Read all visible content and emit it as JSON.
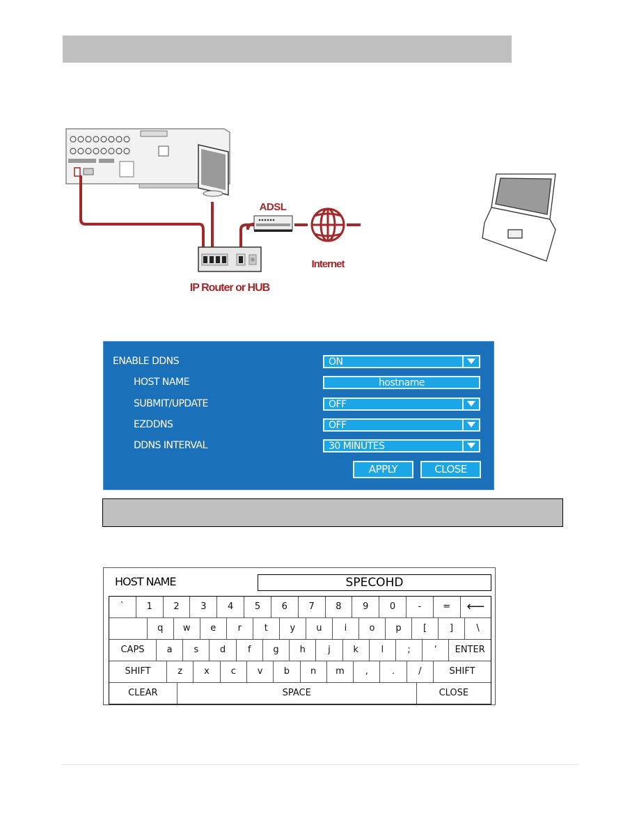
{
  "diagram": {
    "adsl_label": "ADSL",
    "internet_label": "Internet",
    "router_label": "IP Router or HUB",
    "cable_color": "#a3282a"
  },
  "ddns": {
    "rows": [
      {
        "label": "ENABLE DDNS",
        "value": "ON",
        "type": "dropdown"
      },
      {
        "label": "HOST NAME",
        "value": "hostname",
        "type": "text"
      },
      {
        "label": "SUBMIT/UPDATE",
        "value": "OFF",
        "type": "dropdown"
      },
      {
        "label": "EZDDNS",
        "value": "OFF",
        "type": "dropdown"
      },
      {
        "label": "DDNS INTERVAL",
        "value": "30 MINUTES",
        "type": "dropdown"
      }
    ],
    "apply_label": "APPLY",
    "close_label": "CLOSE",
    "bg_color": "#1b70ba",
    "field_color": "#1ba6e8"
  },
  "keyboard": {
    "title": "HOST NAME",
    "input_value": "SPECOHD",
    "rows": [
      [
        {
          "k": "`",
          "w": 1
        },
        {
          "k": "1",
          "w": 1
        },
        {
          "k": "2",
          "w": 1
        },
        {
          "k": "3",
          "w": 1
        },
        {
          "k": "4",
          "w": 1
        },
        {
          "k": "5",
          "w": 1
        },
        {
          "k": "6",
          "w": 1
        },
        {
          "k": "7",
          "w": 1
        },
        {
          "k": "8",
          "w": 1
        },
        {
          "k": "9",
          "w": 1
        },
        {
          "k": "0",
          "w": 1
        },
        {
          "k": "-",
          "w": 1
        },
        {
          "k": "=",
          "w": 1
        },
        {
          "k": "⟵",
          "w": 1.15
        }
      ],
      [
        {
          "k": "",
          "w": 1.45
        },
        {
          "k": "q",
          "w": 1
        },
        {
          "k": "w",
          "w": 1
        },
        {
          "k": "e",
          "w": 1
        },
        {
          "k": "r",
          "w": 1
        },
        {
          "k": "t",
          "w": 1
        },
        {
          "k": "y",
          "w": 1
        },
        {
          "k": "u",
          "w": 1
        },
        {
          "k": "i",
          "w": 1
        },
        {
          "k": "o",
          "w": 1
        },
        {
          "k": "p",
          "w": 1
        },
        {
          "k": "[",
          "w": 1
        },
        {
          "k": "]",
          "w": 1
        },
        {
          "k": "\\",
          "w": 1
        }
      ],
      [
        {
          "k": "CAPS",
          "w": 1.8
        },
        {
          "k": "a",
          "w": 1
        },
        {
          "k": "s",
          "w": 1
        },
        {
          "k": "d",
          "w": 1
        },
        {
          "k": "f",
          "w": 1
        },
        {
          "k": "g",
          "w": 1
        },
        {
          "k": "h",
          "w": 1
        },
        {
          "k": "j",
          "w": 1
        },
        {
          "k": "k",
          "w": 1
        },
        {
          "k": "l",
          "w": 1
        },
        {
          "k": ";",
          "w": 1
        },
        {
          "k": "‘",
          "w": 1
        },
        {
          "k": "ENTER",
          "w": 1.6
        }
      ],
      [
        {
          "k": "SHIFT",
          "w": 2.2
        },
        {
          "k": "z",
          "w": 1
        },
        {
          "k": "x",
          "w": 1
        },
        {
          "k": "c",
          "w": 1
        },
        {
          "k": "v",
          "w": 1
        },
        {
          "k": "b",
          "w": 1
        },
        {
          "k": "n",
          "w": 1
        },
        {
          "k": "m",
          "w": 1
        },
        {
          "k": ",",
          "w": 1
        },
        {
          "k": ".",
          "w": 1
        },
        {
          "k": "/",
          "w": 1
        },
        {
          "k": "SHIFT",
          "w": 2.2
        }
      ],
      [
        {
          "k": "CLEAR",
          "w": 1
        },
        {
          "k": "SPACE",
          "w": 3.55
        },
        {
          "k": "CLOSE",
          "w": 1.1
        }
      ]
    ]
  }
}
